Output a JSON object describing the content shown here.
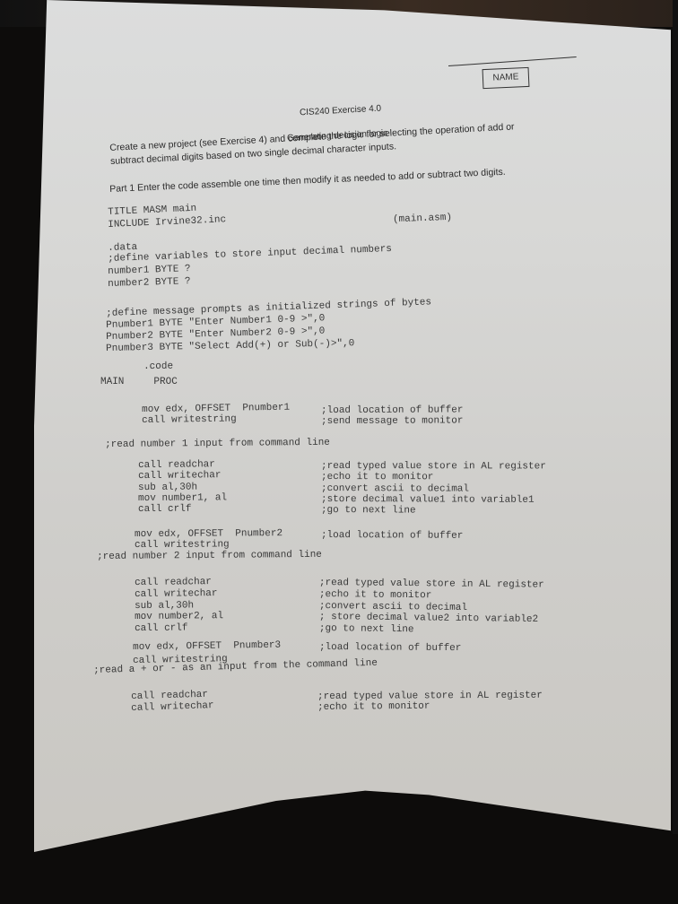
{
  "name_box": {
    "label": "NAME"
  },
  "header": {
    "course": "CIS240 Exercise 4.0",
    "subtitle": "Generating decision logic"
  },
  "instructions": {
    "paragraph_line1": "Create a new project (see Exercise 4) and complete the logic for selecting the operation of add or",
    "paragraph_line2": "subtract decimal digits based on two single decimal character inputs.",
    "part1": "Part 1 Enter the code assemble one time then modify it as needed to add or subtract two digits."
  },
  "code": {
    "filename": "(main.asm)",
    "lines": [
      {
        "code": "TITLE MASM main",
        "comment": ""
      },
      {
        "code": "INCLUDE Irvine32.inc",
        "comment": ""
      },
      {
        "code": ".data",
        "comment": ""
      },
      {
        "code": ";define variables to store input decimal numbers",
        "comment": ""
      },
      {
        "code": "number1 BYTE ?",
        "comment": ""
      },
      {
        "code": "number2 BYTE ?",
        "comment": ""
      },
      {
        "code": ";define message prompts as initialized strings of bytes",
        "comment": ""
      },
      {
        "code": "Pnumber1 BYTE \"Enter Number1 0-9 >\",0",
        "comment": ""
      },
      {
        "code": "Pnumber2 BYTE \"Enter Number2 0-9 >\",0",
        "comment": ""
      },
      {
        "code": "Pnumber3 BYTE \"Select Add(+) or Sub(-)>\",0",
        "comment": ""
      },
      {
        "code": ".code",
        "comment": ""
      },
      {
        "code": "MAIN     PROC",
        "comment": ""
      },
      {
        "code": "mov edx, OFFSET  Pnumber1",
        "comment": ";load location of buffer"
      },
      {
        "code": "call writestring",
        "comment": ";send message to monitor"
      },
      {
        "code": ";read number 1 input from command line",
        "comment": ""
      },
      {
        "code": "call readchar",
        "comment": ";read typed value store in AL register"
      },
      {
        "code": "call writechar",
        "comment": ";echo it to monitor"
      },
      {
        "code": "sub al,30h",
        "comment": ";convert ascii to decimal"
      },
      {
        "code": "mov number1, al",
        "comment": ";store decimal value1 into variable1"
      },
      {
        "code": "call crlf",
        "comment": ";go to next line"
      },
      {
        "code": "mov edx, OFFSET  Pnumber2",
        "comment": ";load location of buffer"
      },
      {
        "code": "call writestring",
        "comment": ""
      },
      {
        "code": ";read number 2 input from command line",
        "comment": ""
      },
      {
        "code": "call readchar",
        "comment": ";read typed value store in AL register"
      },
      {
        "code": "call writechar",
        "comment": ";echo it to monitor"
      },
      {
        "code": "sub al,30h",
        "comment": ";convert ascii to decimal"
      },
      {
        "code": "mov number2, al",
        "comment": "; store decimal value2 into variable2"
      },
      {
        "code": "call crlf",
        "comment": ";go to next line"
      },
      {
        "code": "mov edx, OFFSET  Pnumber3",
        "comment": ";load location of buffer"
      },
      {
        "code": "call writestring",
        "comment": ""
      },
      {
        "code": ";read a + or - as an input from the command line",
        "comment": ""
      },
      {
        "code": "call readchar",
        "comment": ";read typed value store in AL register"
      },
      {
        "code": "call writechar",
        "comment": ";echo it to monitor"
      }
    ]
  }
}
